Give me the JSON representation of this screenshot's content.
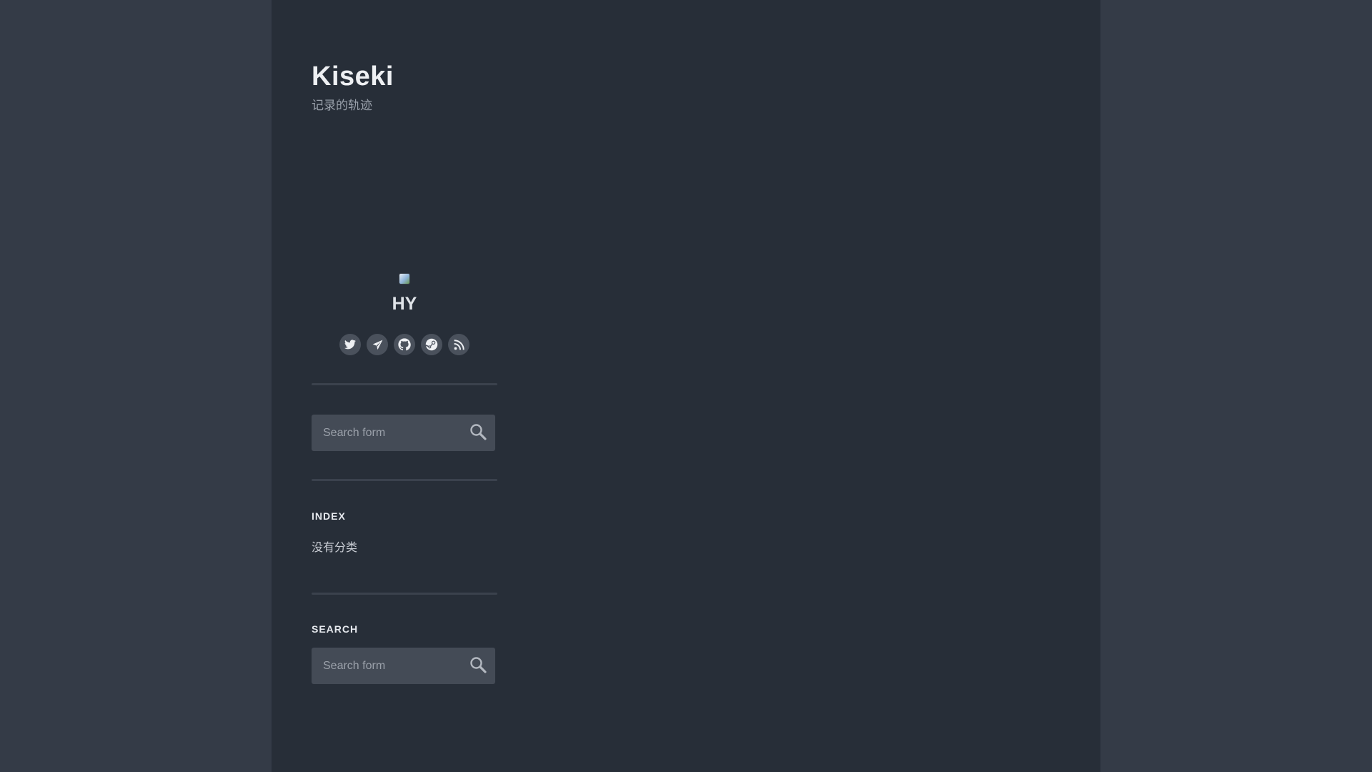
{
  "site": {
    "title": "Kiseki",
    "subtitle": "记录的轨迹"
  },
  "profile": {
    "name": "HY"
  },
  "social": [
    {
      "icon": "twitter-icon"
    },
    {
      "icon": "telegram-icon"
    },
    {
      "icon": "github-icon"
    },
    {
      "icon": "steam-icon"
    },
    {
      "icon": "rss-icon"
    }
  ],
  "search_top": {
    "placeholder": "Search form"
  },
  "index_widget": {
    "title": "INDEX",
    "categories": [
      "没有分类"
    ]
  },
  "search_widget": {
    "title": "SEARCH",
    "placeholder": "Search form"
  },
  "colors": {
    "page_background": "#343b47",
    "panel_background": "#272e38",
    "input_background": "#444b56",
    "icon_button_background": "#4a515c"
  }
}
